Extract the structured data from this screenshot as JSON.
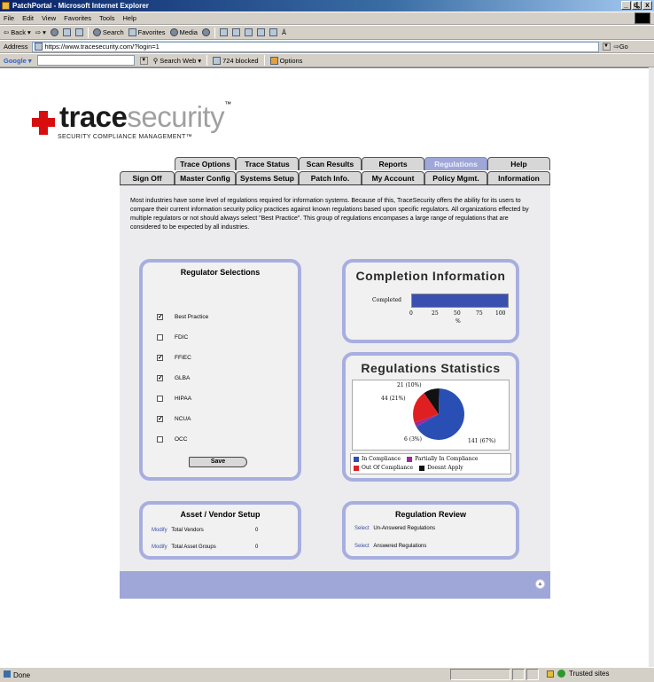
{
  "window": {
    "title": "PatchPortal - Microsoft Internet Explorer",
    "min": "_",
    "max": "ȡ",
    "close": "x"
  },
  "menu": [
    "File",
    "Edit",
    "View",
    "Favorites",
    "Tools",
    "Help"
  ],
  "toolbar": {
    "back": "Back",
    "search": "Search",
    "favorites": "Favorites",
    "media": "Media"
  },
  "address": {
    "label": "Address",
    "url": "https://www.tracesecurity.com/?login=1",
    "go": "Go"
  },
  "google": {
    "label": "Google",
    "search_web": "Search Web",
    "blocked": "724 blocked",
    "options": "Options"
  },
  "logo": {
    "trace": "trace",
    "security": "security",
    "tm": "™",
    "tagline": "SECURITY COMPLIANCE MANAGEMENT™"
  },
  "tabs_top": [
    "Trace Options",
    "Trace Status",
    "Scan Results",
    "Reports",
    "Regulations",
    "Help"
  ],
  "tabs_bottom": [
    "Sign Off",
    "Master Config",
    "Systems Setup",
    "Patch Info.",
    "My Account",
    "Policy Mgmt.",
    "Information"
  ],
  "intro": "Most industries have some level of regulations required for information systems. Because of this, TraceSecurity offers the ability for its users to compare their current information security policy practices against known regulations based upon specific regulators. All organizations effected by multiple regulators or not should always select \"Best Practice\". This group of regulations encompases a large range of regulations that are considered to be expected by all industries.",
  "regulators": {
    "title": "Regulator Selections",
    "items": [
      {
        "label": "Best Practice",
        "checked": true
      },
      {
        "label": "FDIC",
        "checked": false
      },
      {
        "label": "FFIEC",
        "checked": true
      },
      {
        "label": "GLBA",
        "checked": true
      },
      {
        "label": "HIPAA",
        "checked": false
      },
      {
        "label": "NCUA",
        "checked": true
      },
      {
        "label": "OCC",
        "checked": false
      }
    ],
    "save": "Save"
  },
  "completion": {
    "title": "Completion Information",
    "label": "Completed",
    "ticks": [
      "0",
      "25",
      "50",
      "75",
      "100"
    ],
    "unit": "%",
    "value_percent": 100
  },
  "stats": {
    "title": "Regulations Statistics",
    "labels": {
      "a": "21 (10%)",
      "b": "44 (21%)",
      "c": "6 (3%)",
      "d": "141 (67%)"
    },
    "legend": [
      "In Compliance",
      "Partially In Compliance",
      "Out Of Compliance",
      "Doesnt Apply"
    ],
    "colors": {
      "in": "#2a4fb4",
      "partial": "#9a2a9a",
      "out": "#e02020",
      "na": "#111111"
    }
  },
  "chart_data": {
    "type": "pie",
    "title": "Regulations Statistics",
    "categories": [
      "In Compliance",
      "Partially In Compliance",
      "Out Of Compliance",
      "Doesnt Apply"
    ],
    "values": [
      141,
      6,
      44,
      21
    ],
    "percents": [
      67,
      3,
      21,
      10
    ]
  },
  "asset": {
    "title": "Asset / Vendor Setup",
    "rows": [
      {
        "action": "Modify",
        "label": "Total Vendors",
        "value": "0"
      },
      {
        "action": "Modify",
        "label": "Total Asset Groups",
        "value": "0"
      }
    ]
  },
  "review": {
    "title": "Regulation Review",
    "rows": [
      {
        "action": "Select",
        "label": "Un-Answered Regulations"
      },
      {
        "action": "Select",
        "label": "Answered Regulations"
      }
    ]
  },
  "status": {
    "text": "Done",
    "zone": "Trusted sites"
  }
}
